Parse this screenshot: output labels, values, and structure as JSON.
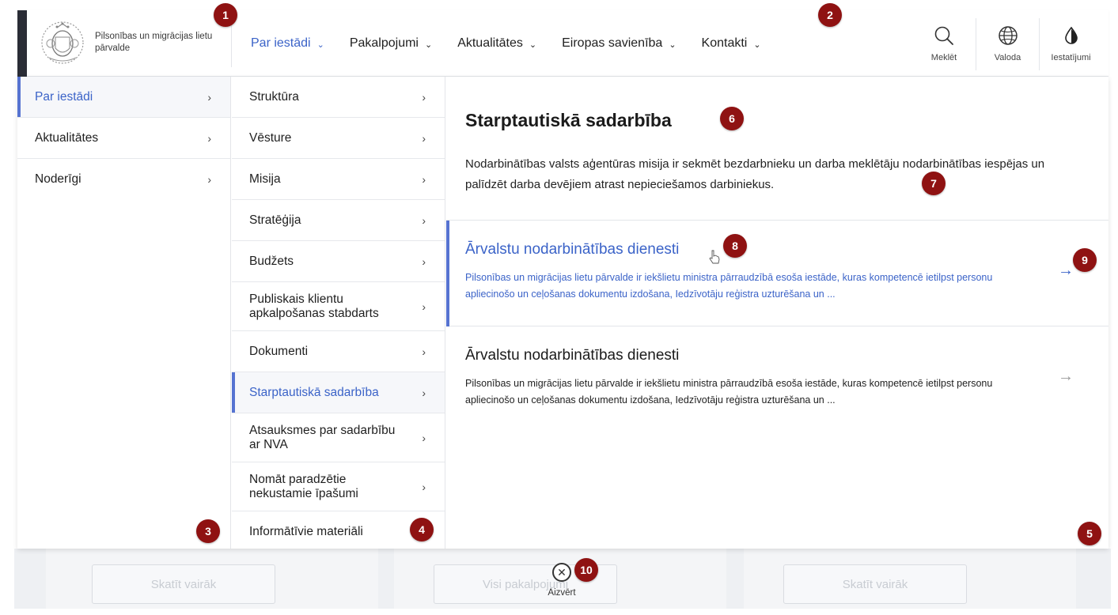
{
  "header": {
    "org_name": "Pilsonības un migrācijas lietu pārvalde",
    "nav": [
      {
        "label": "Par iestādi"
      },
      {
        "label": "Pakalpojumi"
      },
      {
        "label": "Aktualitātes"
      },
      {
        "label": "Eiropas savienība"
      },
      {
        "label": "Kontakti"
      }
    ],
    "tools": {
      "search": "Meklēt",
      "language": "Valoda",
      "settings": "Iestatījumi"
    }
  },
  "menu_level1": [
    {
      "label": "Par iestādi"
    },
    {
      "label": "Aktualitātes"
    },
    {
      "label": "Noderīgi"
    }
  ],
  "menu_level2": [
    {
      "label": "Struktūra"
    },
    {
      "label": "Vēsture"
    },
    {
      "label": "Misija"
    },
    {
      "label": "Stratēģija"
    },
    {
      "label": "Budžets"
    },
    {
      "label": "Publiskais klientu apkalpošanas stabdarts"
    },
    {
      "label": "Dokumenti"
    },
    {
      "label": "Starptautiskā sadarbība"
    },
    {
      "label": "Atsauksmes par sadarbību ar NVA"
    },
    {
      "label": "Nomāt paradzētie nekustamie īpašumi"
    },
    {
      "label": "Informātīvie materiāli"
    }
  ],
  "detail": {
    "title": "Starptautiskā sadarbība",
    "description": "Nodarbinātības valsts aģentūras misija ir sekmēt bezdarbnieku un darba meklētāju nodarbinātības iespējas un palīdzēt darba devējiem atrast nepieciešamos darbiniekus.",
    "cards": [
      {
        "title": "Ārvalstu nodarbinātības dienesti",
        "text": "Pilsonības un migrācijas lietu pārvalde ir iekšlietu ministra pārraudzībā esoša iestāde, kuras kompetencē ietilpst personu apliecinošo un ceļošanas dokumentu izdošana, Iedzīvotāju reģistra uzturēšana un ..."
      },
      {
        "title": "Ārvalstu nodarbinātības dienesti",
        "text": "Pilsonības un migrācijas lietu pārvalde ir iekšlietu ministra pārraudzībā esoša iestāde, kuras kompetencē ietilpst personu apliecinošo un ceļošanas dokumentu izdošana, Iedzīvotāju reģistra uzturēšana un ..."
      }
    ]
  },
  "background": {
    "buttons": [
      "Skatīt vairāk",
      "Visi pakalpojumi",
      "Skatīt vairāk"
    ]
  },
  "close_label": "Aizvērt",
  "markers": [
    "1",
    "2",
    "3",
    "4",
    "5",
    "6",
    "7",
    "8",
    "9",
    "10"
  ],
  "colors": {
    "accent": "#3b63c8",
    "marker": "#8f1212"
  }
}
